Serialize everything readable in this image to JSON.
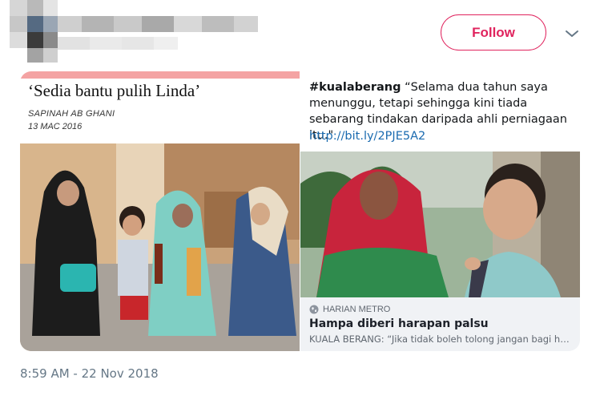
{
  "header": {
    "follow_label": "Follow",
    "caret_icon": "chevron-down-icon",
    "accent_color": "#e0245e"
  },
  "left_image": {
    "headline": "‘Sedia bantu pulih Linda’",
    "byline": "SAPINAH AB GHANI",
    "date": "13 MAC 2016"
  },
  "right_card": {
    "hashtag": "#kualaberang",
    "quote": " “Selama dua tahun saya menunggu, tetapi sehingga kini tiada sebarang tindakan daripada ahli perniagaan itu.\"",
    "link": "http://bit.ly/2PJE5A2",
    "preview": {
      "source": "HARIAN METRO",
      "title": "Hampa diberi harapan palsu",
      "description": "KUALA BERANG: “Jika tidak boleh tolong jangan bagi har..."
    }
  },
  "footer": {
    "timestamp": "8:59 AM - 22 Nov 2018"
  }
}
